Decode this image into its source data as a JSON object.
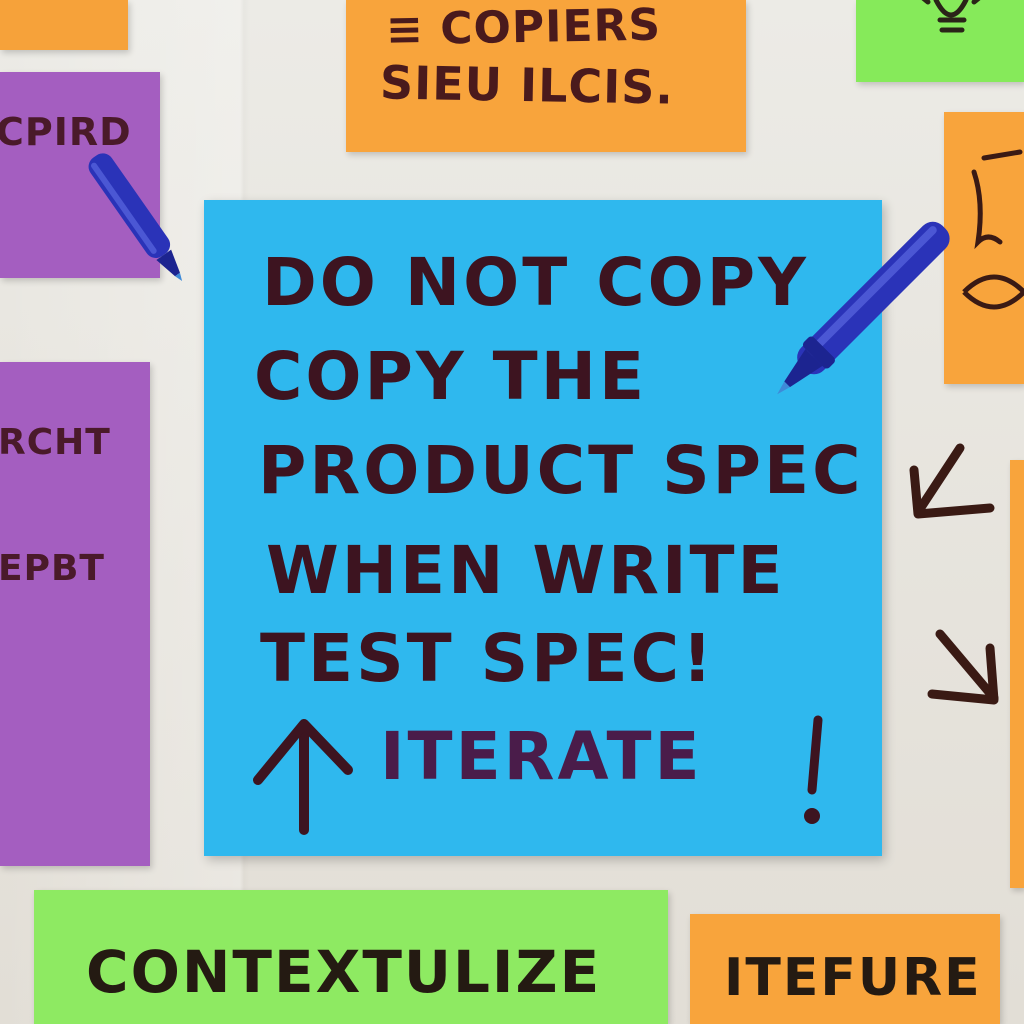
{
  "scene": "sticky-note wall",
  "colors": {
    "wall": "#e9e6df",
    "blue_note": "#2fb8ee",
    "orange_note": "#f8a43c",
    "green_note": "#8eea62",
    "purple_note": "#a45ec0",
    "ink": "#3d1420",
    "marker_blue": "#2a33b8"
  },
  "notes": {
    "top_orange": {
      "line1": "≡ COPIERS",
      "line2": "SIEU ILCIS."
    },
    "left_purple_upper": {
      "line1": "CPIRD"
    },
    "left_purple_lower": {
      "line1": "RCHT",
      "line2": "EPBT"
    },
    "main": {
      "lines": [
        "DO NOT COPY",
        "COPY THE",
        "PRODUCT SPEC",
        "WHEN WRITE",
        "TEST SPEC!",
        "ITERATE"
      ]
    },
    "bottom_green": {
      "line1": "CONTEXTULIZE"
    },
    "bottom_orange": {
      "line1": "ITEFURE"
    }
  },
  "icons": {
    "marker_left": "blue-marker-icon",
    "marker_right": "blue-marker-icon",
    "arrow_down_left": "arrow-down-left-icon",
    "arrow_down_right": "arrow-down-right-icon",
    "arrow_up": "arrow-up-icon",
    "lightbulb": "lightbulb-icon"
  }
}
